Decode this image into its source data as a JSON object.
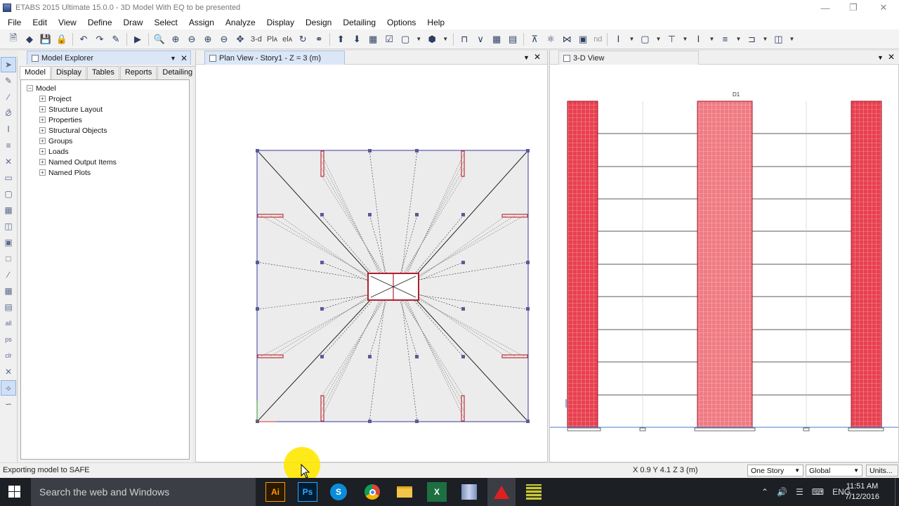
{
  "window": {
    "title": "ETABS 2015 Ultimate 15.0.0 - 3D Model With EQ to be presented"
  },
  "menu": [
    "File",
    "Edit",
    "View",
    "Define",
    "Draw",
    "Select",
    "Assign",
    "Analyze",
    "Display",
    "Design",
    "Detailing",
    "Options",
    "Help"
  ],
  "toolbar": {
    "btn_3d": "3-d",
    "btn_plan": "Plᴀ",
    "btn_elev": "elᴀ",
    "btn_nd": "nd"
  },
  "explorer": {
    "title": "Model Explorer",
    "tabs": [
      "Model",
      "Display",
      "Tables",
      "Reports",
      "Detailing"
    ],
    "root": "Model",
    "items": [
      "Project",
      "Structure Layout",
      "Properties",
      "Structural Objects",
      "Groups",
      "Loads",
      "Named Output Items",
      "Named Plots"
    ]
  },
  "plan_view": {
    "title": "Plan View - Story1 - Z = 3 (m)"
  },
  "view3d": {
    "title": "3-D View",
    "label_d1": "D1"
  },
  "status": {
    "message": "Exporting model to SAFE",
    "coords": "X 0.9  Y 4.1  Z 3 (m)",
    "story_select": "One Story",
    "coord_select": "Global",
    "units_button": "Units..."
  },
  "taskbar": {
    "search_placeholder": "Search the web and Windows",
    "apps": [
      "Ai",
      "Ps",
      "Skype",
      "Chrome",
      "Explorer",
      "Excel",
      "ETABS",
      "Autodesk",
      "SAFE"
    ],
    "lang": "ENG",
    "time": "11:51 AM",
    "date": "7/12/2016"
  },
  "colors": {
    "accent": "#dbe7f7",
    "wall_red": "#e8404f",
    "wall_pink": "#f07a83",
    "taskbar": "#1c1f24"
  }
}
